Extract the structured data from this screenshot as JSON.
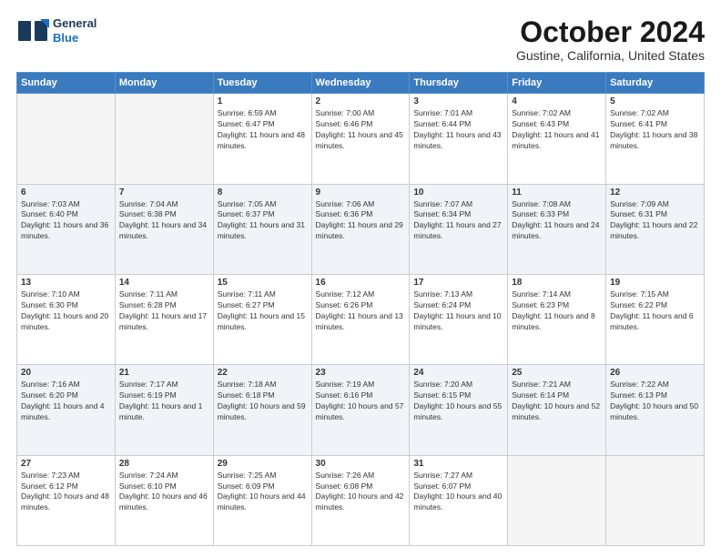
{
  "header": {
    "logo_line1": "General",
    "logo_line2": "Blue",
    "month": "October 2024",
    "location": "Gustine, California, United States"
  },
  "weekdays": [
    "Sunday",
    "Monday",
    "Tuesday",
    "Wednesday",
    "Thursday",
    "Friday",
    "Saturday"
  ],
  "weeks": [
    [
      {
        "day": "",
        "info": ""
      },
      {
        "day": "",
        "info": ""
      },
      {
        "day": "1",
        "info": "Sunrise: 6:59 AM\nSunset: 6:47 PM\nDaylight: 11 hours and 48 minutes."
      },
      {
        "day": "2",
        "info": "Sunrise: 7:00 AM\nSunset: 6:46 PM\nDaylight: 11 hours and 45 minutes."
      },
      {
        "day": "3",
        "info": "Sunrise: 7:01 AM\nSunset: 6:44 PM\nDaylight: 11 hours and 43 minutes."
      },
      {
        "day": "4",
        "info": "Sunrise: 7:02 AM\nSunset: 6:43 PM\nDaylight: 11 hours and 41 minutes."
      },
      {
        "day": "5",
        "info": "Sunrise: 7:02 AM\nSunset: 6:41 PM\nDaylight: 11 hours and 38 minutes."
      }
    ],
    [
      {
        "day": "6",
        "info": "Sunrise: 7:03 AM\nSunset: 6:40 PM\nDaylight: 11 hours and 36 minutes."
      },
      {
        "day": "7",
        "info": "Sunrise: 7:04 AM\nSunset: 6:38 PM\nDaylight: 11 hours and 34 minutes."
      },
      {
        "day": "8",
        "info": "Sunrise: 7:05 AM\nSunset: 6:37 PM\nDaylight: 11 hours and 31 minutes."
      },
      {
        "day": "9",
        "info": "Sunrise: 7:06 AM\nSunset: 6:36 PM\nDaylight: 11 hours and 29 minutes."
      },
      {
        "day": "10",
        "info": "Sunrise: 7:07 AM\nSunset: 6:34 PM\nDaylight: 11 hours and 27 minutes."
      },
      {
        "day": "11",
        "info": "Sunrise: 7:08 AM\nSunset: 6:33 PM\nDaylight: 11 hours and 24 minutes."
      },
      {
        "day": "12",
        "info": "Sunrise: 7:09 AM\nSunset: 6:31 PM\nDaylight: 11 hours and 22 minutes."
      }
    ],
    [
      {
        "day": "13",
        "info": "Sunrise: 7:10 AM\nSunset: 6:30 PM\nDaylight: 11 hours and 20 minutes."
      },
      {
        "day": "14",
        "info": "Sunrise: 7:11 AM\nSunset: 6:28 PM\nDaylight: 11 hours and 17 minutes."
      },
      {
        "day": "15",
        "info": "Sunrise: 7:11 AM\nSunset: 6:27 PM\nDaylight: 11 hours and 15 minutes."
      },
      {
        "day": "16",
        "info": "Sunrise: 7:12 AM\nSunset: 6:26 PM\nDaylight: 11 hours and 13 minutes."
      },
      {
        "day": "17",
        "info": "Sunrise: 7:13 AM\nSunset: 6:24 PM\nDaylight: 11 hours and 10 minutes."
      },
      {
        "day": "18",
        "info": "Sunrise: 7:14 AM\nSunset: 6:23 PM\nDaylight: 11 hours and 8 minutes."
      },
      {
        "day": "19",
        "info": "Sunrise: 7:15 AM\nSunset: 6:22 PM\nDaylight: 11 hours and 6 minutes."
      }
    ],
    [
      {
        "day": "20",
        "info": "Sunrise: 7:16 AM\nSunset: 6:20 PM\nDaylight: 11 hours and 4 minutes."
      },
      {
        "day": "21",
        "info": "Sunrise: 7:17 AM\nSunset: 6:19 PM\nDaylight: 11 hours and 1 minute."
      },
      {
        "day": "22",
        "info": "Sunrise: 7:18 AM\nSunset: 6:18 PM\nDaylight: 10 hours and 59 minutes."
      },
      {
        "day": "23",
        "info": "Sunrise: 7:19 AM\nSunset: 6:16 PM\nDaylight: 10 hours and 57 minutes."
      },
      {
        "day": "24",
        "info": "Sunrise: 7:20 AM\nSunset: 6:15 PM\nDaylight: 10 hours and 55 minutes."
      },
      {
        "day": "25",
        "info": "Sunrise: 7:21 AM\nSunset: 6:14 PM\nDaylight: 10 hours and 52 minutes."
      },
      {
        "day": "26",
        "info": "Sunrise: 7:22 AM\nSunset: 6:13 PM\nDaylight: 10 hours and 50 minutes."
      }
    ],
    [
      {
        "day": "27",
        "info": "Sunrise: 7:23 AM\nSunset: 6:12 PM\nDaylight: 10 hours and 48 minutes."
      },
      {
        "day": "28",
        "info": "Sunrise: 7:24 AM\nSunset: 6:10 PM\nDaylight: 10 hours and 46 minutes."
      },
      {
        "day": "29",
        "info": "Sunrise: 7:25 AM\nSunset: 6:09 PM\nDaylight: 10 hours and 44 minutes."
      },
      {
        "day": "30",
        "info": "Sunrise: 7:26 AM\nSunset: 6:08 PM\nDaylight: 10 hours and 42 minutes."
      },
      {
        "day": "31",
        "info": "Sunrise: 7:27 AM\nSunset: 6:07 PM\nDaylight: 10 hours and 40 minutes."
      },
      {
        "day": "",
        "info": ""
      },
      {
        "day": "",
        "info": ""
      }
    ]
  ]
}
